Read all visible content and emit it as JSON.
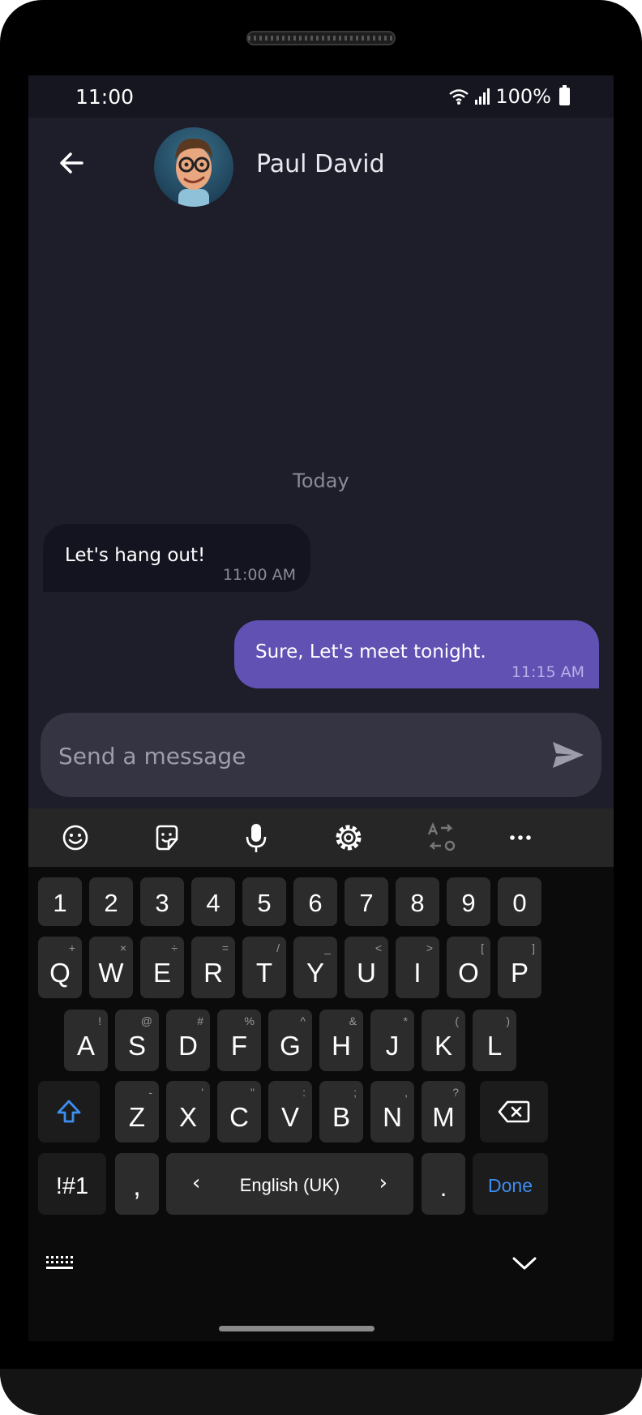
{
  "status_bar": {
    "time": "11:00",
    "battery_text": "100%"
  },
  "contact": {
    "name": "Paul David"
  },
  "conversation": {
    "day_label": "Today",
    "messages": [
      {
        "text": "Let's hang out!",
        "time": "11:00 AM",
        "direction": "incoming"
      },
      {
        "text": "Sure, Let's meet tonight.",
        "time": "11:15 AM",
        "direction": "outgoing"
      }
    ]
  },
  "composer": {
    "placeholder": "Send a message",
    "value": ""
  },
  "keyboard": {
    "toolbar": [
      "emoji-icon",
      "sticker-icon",
      "microphone-icon",
      "settings-icon",
      "translate-icon",
      "more-icon"
    ],
    "number_row": [
      "1",
      "2",
      "3",
      "4",
      "5",
      "6",
      "7",
      "8",
      "9",
      "0"
    ],
    "row1": {
      "keys": [
        "Q",
        "W",
        "E",
        "R",
        "T",
        "Y",
        "U",
        "I",
        "O",
        "P"
      ],
      "hints": [
        "+",
        "×",
        "÷",
        "=",
        "/",
        "_",
        "<",
        ">",
        "[",
        "]"
      ]
    },
    "row2": {
      "keys": [
        "A",
        "S",
        "D",
        "F",
        "G",
        "H",
        "J",
        "K",
        "L"
      ],
      "hints": [
        "!",
        "@",
        "#",
        "%",
        "^",
        "&",
        "*",
        "(",
        ")"
      ]
    },
    "row3": {
      "keys": [
        "Z",
        "X",
        "C",
        "V",
        "B",
        "N",
        "M"
      ],
      "hints": [
        "-",
        "'",
        "\"",
        ":",
        ";",
        ",",
        "?"
      ]
    },
    "symbols_label": "!#1",
    "comma": ",",
    "language": "English (UK)",
    "lang_left": "‹",
    "lang_right": "›",
    "period": ".",
    "done_label": "Done"
  },
  "colors": {
    "background": "#1e1d2a",
    "outgoing_bubble": "#6051b3",
    "incoming_bubble": "#141420",
    "accent": "#3d8ef0"
  }
}
